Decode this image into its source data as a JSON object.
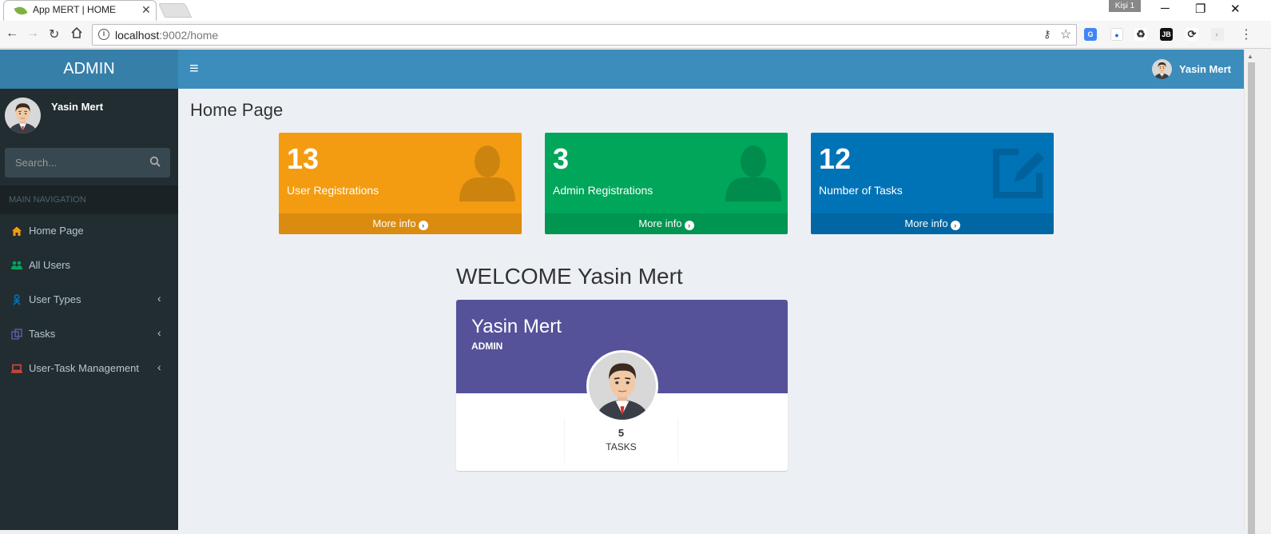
{
  "browser": {
    "tab_title": "App MERT | HOME",
    "person_label": "Kişi 1",
    "url_host": "localhost",
    "url_rest": ":9002/home",
    "ext_jb": "JB"
  },
  "header": {
    "logo": "ADMIN",
    "user_name": "Yasin Mert"
  },
  "sidebar": {
    "user_name": "Yasin Mert",
    "search_placeholder": "Search...",
    "nav_header": "MAIN NAVIGATION",
    "items": [
      {
        "label": "Home Page",
        "icon": "home-icon",
        "color": "#f39c12"
      },
      {
        "label": "All Users",
        "icon": "users-icon",
        "color": "#00a65a"
      },
      {
        "label": "User Types",
        "icon": "user-types-icon",
        "color": "#0073b7"
      },
      {
        "label": "Tasks",
        "icon": "tasks-icon",
        "color": "#605ca8"
      },
      {
        "label": "User-Task Management",
        "icon": "laptop-icon",
        "color": "#dd4b39"
      }
    ]
  },
  "main": {
    "title": "Home Page",
    "boxes": [
      {
        "number": "13",
        "label": "User Registrations",
        "footer": "More info",
        "color": "#f39c12",
        "icon": "user-icon"
      },
      {
        "number": "3",
        "label": "Admin Registrations",
        "footer": "More info",
        "color": "#00a65a",
        "icon": "user-icon"
      },
      {
        "number": "12",
        "label": "Number of Tasks",
        "footer": "More info",
        "color": "#0073b7",
        "icon": "edit-icon"
      }
    ],
    "welcome": "WELCOME Yasin Mert",
    "widget": {
      "name": "Yasin Mert",
      "role": "ADMIN",
      "stat_value": "5",
      "stat_label": "TASKS",
      "header_color": "#555299"
    }
  }
}
